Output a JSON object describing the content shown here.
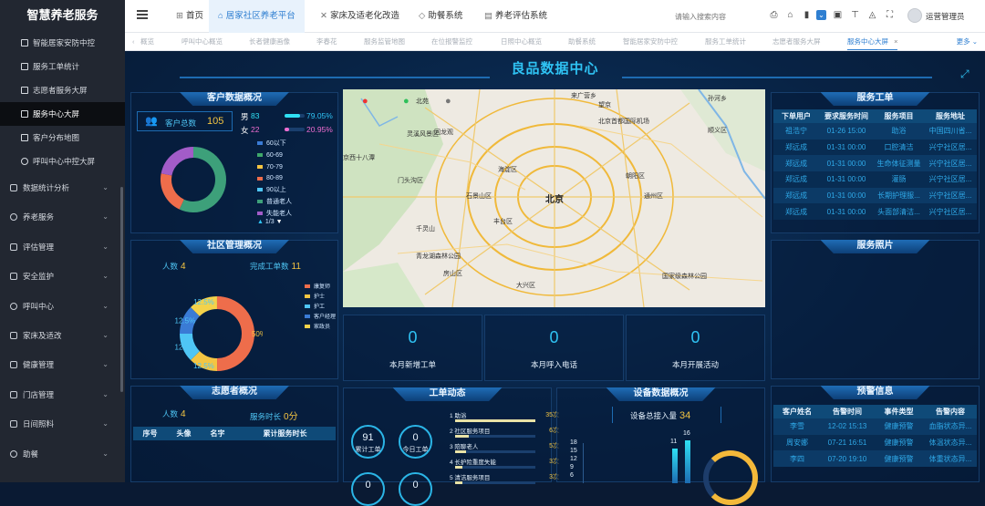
{
  "sidebar": {
    "title": "智慧养老服务",
    "subitems": [
      {
        "label": "智能居家安防中控"
      },
      {
        "label": "服务工单统计"
      },
      {
        "label": "志愿者服务大屏"
      },
      {
        "label": "服务中心大屏"
      },
      {
        "label": "客户分布地图"
      },
      {
        "label": "呼叫中心中控大屏"
      }
    ],
    "items": [
      {
        "label": "数据统计分析"
      },
      {
        "label": "养老服务"
      },
      {
        "label": "评估管理"
      },
      {
        "label": "安全监护"
      },
      {
        "label": "呼叫中心"
      },
      {
        "label": "家床及适改"
      },
      {
        "label": "健康管理"
      },
      {
        "label": "门店管理"
      },
      {
        "label": "日间照料"
      },
      {
        "label": "助餐"
      }
    ]
  },
  "topbar": {
    "nav": [
      {
        "label": "首页"
      },
      {
        "label": "居家社区养老平台"
      },
      {
        "label": "家床及适老化改造"
      },
      {
        "label": "助餐系统"
      },
      {
        "label": "养老评估系统"
      }
    ],
    "search_placeholder": "请输入搜索内容",
    "username": "运营管理员"
  },
  "tabs": [
    "概览",
    "呼叫中心概览",
    "长者健康画像",
    "李春花",
    "服务监管地图",
    "在位报警监控",
    "日照中心概览",
    "助餐系统",
    "智能居家安防中控",
    "服务工单统计",
    "志愿者服务大屏",
    "服务中心大屏"
  ],
  "more_label": "更多",
  "screen": {
    "title": "良品数据中心",
    "customer": {
      "title": "客户数据概况",
      "total_label": "客户总数",
      "total": "105",
      "male_label": "男",
      "male_count": "83",
      "male_pct": "79.05%",
      "male_fraction": 0.7905,
      "female_label": "女",
      "female_count": "22",
      "female_pct": "20.95%",
      "female_fraction": 0.2095,
      "legend": [
        {
          "label": "60以下",
          "color": "#3a7bd5"
        },
        {
          "label": "60-69",
          "color": "#3fa86a"
        },
        {
          "label": "70-79",
          "color": "#f4c542"
        },
        {
          "label": "80-89",
          "color": "#ee6d4b"
        },
        {
          "label": "90以上",
          "color": "#4fc6f5"
        },
        {
          "label": "普通老人",
          "color": "#3da07a"
        },
        {
          "label": "失能老人",
          "color": "#a25cc8"
        }
      ],
      "pager": "1/3",
      "age_chart_data": {
        "type": "pie",
        "slices": [
          {
            "label": "普通老人",
            "value": 0.57,
            "color": "#3da07a"
          },
          {
            "label": "80-89",
            "value": 0.21,
            "color": "#ee6d4b"
          },
          {
            "label": "失能老人",
            "value": 0.22,
            "color": "#a25cc8"
          }
        ]
      }
    },
    "community": {
      "title": "社区管理概况",
      "people_label": "人数",
      "people": "4",
      "done_label": "完成工单数",
      "done": "11",
      "legend": [
        {
          "label": "康复师",
          "color": "#ee6d4b"
        },
        {
          "label": "护士",
          "color": "#f4c542"
        },
        {
          "label": "护工",
          "color": "#4fc6f5"
        },
        {
          "label": "客户经理",
          "color": "#3a7bd5"
        },
        {
          "label": "家政员",
          "color": "#f4d24a"
        }
      ]
    },
    "chart_data": {
      "type": "pie",
      "labels": [
        "康复师",
        "护士",
        "护工",
        "客户经理",
        "家政员"
      ],
      "values": [
        50,
        12.5,
        12.5,
        12.5,
        12.5
      ],
      "value_labels": [
        "50%",
        "12.5%",
        "12.5%",
        "12.5%",
        "12.5%"
      ],
      "colors": [
        "#ee6d4b",
        "#f4c542",
        "#4fc6f5",
        "#3a7bd5",
        "#f4d24a"
      ]
    },
    "volunteer": {
      "title": "志愿者概况",
      "people_label": "人数",
      "people": "4",
      "hours_label": "服务时长",
      "hours": "0分",
      "columns": [
        "序号",
        "头像",
        "名字",
        "累计服务时长"
      ]
    },
    "map": {
      "center_label": "北京",
      "places": [
        "来广营乡",
        "北京首都国际机场",
        "北苑",
        "望京",
        "顺义区",
        "海淀区",
        "回龙观",
        "门头沟区",
        "石景山区",
        "朝阳区",
        "通州区",
        "丰台区",
        "千灵山",
        "青龙湖森林公园",
        "房山区",
        "大兴区",
        "京西十八潭",
        "灵溪风景区",
        "孙河乡",
        "国家级森林公园"
      ]
    },
    "kpis": [
      {
        "value": "0",
        "label": "本月新增工单"
      },
      {
        "value": "0",
        "label": "本月呼入电话"
      },
      {
        "value": "0",
        "label": "本月开展活动"
      }
    ],
    "service_orders": {
      "title": "服务工单",
      "columns": [
        "下单用户",
        "要求服务时间",
        "服务项目",
        "服务地址"
      ],
      "rows": [
        [
          "祖浩宁",
          "01-26 15:00",
          "助浴",
          "中国四川省..."
        ],
        [
          "郑远成",
          "01-31 00:00",
          "口腔清洁",
          "兴宁社区居..."
        ],
        [
          "郑远成",
          "01-31 00:00",
          "生命体征测量",
          "兴宁社区居..."
        ],
        [
          "郑远成",
          "01-31 00:00",
          "灌肠",
          "兴宁社区居..."
        ],
        [
          "郑远成",
          "01-31 00:00",
          "长期护理服...",
          "兴宁社区居..."
        ],
        [
          "郑远成",
          "01-31 00:00",
          "头面部清洁...",
          "兴宁社区居..."
        ]
      ]
    },
    "photos": {
      "title": "服务照片"
    },
    "work_orders": {
      "title": "工单动态",
      "circle1_value": "91",
      "circle1_label": "累计工单",
      "circle2_value": "0",
      "circle2_label": "今日工单",
      "circle3_value": "0",
      "circle4_value": "0",
      "items": [
        {
          "rank": "1",
          "label": "助浴",
          "count": "35次",
          "fraction": 1.0
        },
        {
          "rank": "2",
          "label": "社区服务项目",
          "count": "6次",
          "fraction": 0.17
        },
        {
          "rank": "3",
          "label": "陪聊老人",
          "count": "5次",
          "fraction": 0.14
        },
        {
          "rank": "4",
          "label": "长护险重度失能",
          "count": "3次",
          "fraction": 0.09
        },
        {
          "rank": "5",
          "label": "清洁服务项目",
          "count": "3次",
          "fraction": 0.09
        }
      ]
    },
    "devices": {
      "title": "设备数据概况",
      "total_label": "设备总接入量",
      "total": "34",
      "bar_labels": [
        "11",
        "16"
      ],
      "y_ticks": [
        "18",
        "15",
        "12",
        "9",
        "6"
      ]
    },
    "alerts": {
      "title": "预警信息",
      "columns": [
        "客户姓名",
        "告警时间",
        "事件类型",
        "告警内容"
      ],
      "rows": [
        [
          "李雪",
          "12-02 15:13",
          "健康预警",
          "血脂状态异..."
        ],
        [
          "周安娜",
          "07-21 16:51",
          "健康预警",
          "体温状态异..."
        ],
        [
          "李四",
          "07-20 19:10",
          "健康预警",
          "体重状态异..."
        ]
      ]
    }
  }
}
